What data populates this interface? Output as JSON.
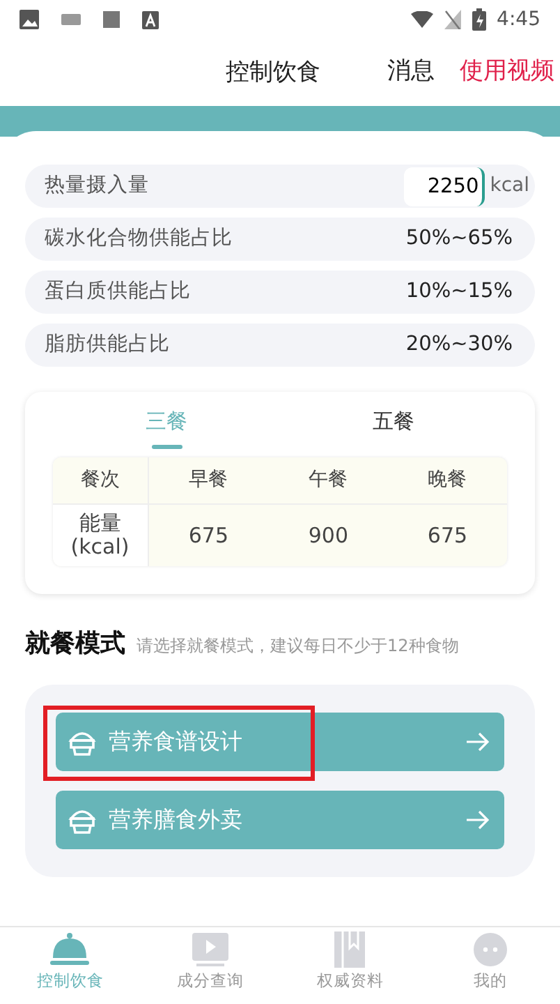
{
  "status_bar": {
    "time": "4:45"
  },
  "header": {
    "title": "控制饮食",
    "actions": [
      {
        "label": "消息",
        "kind": "plain"
      },
      {
        "label": "使用视频",
        "kind": "accent"
      }
    ]
  },
  "targets": [
    {
      "label": "热量摄入量",
      "kind": "input",
      "value": "2250",
      "unit": "kcal"
    },
    {
      "label": "碳水化合物供能占比",
      "kind": "text",
      "value": "50%~65%"
    },
    {
      "label": "蛋白质供能占比",
      "kind": "text",
      "value": "10%~15%"
    },
    {
      "label": "脂肪供能占比",
      "kind": "text",
      "value": "20%~30%"
    }
  ],
  "meal_tabs": [
    {
      "label": "三餐",
      "selected": true
    },
    {
      "label": "五餐",
      "selected": false
    }
  ],
  "table": {
    "columns": [
      "餐次",
      "早餐",
      "午餐",
      "晚餐"
    ],
    "rows": [
      {
        "cells": [
          "能量\n(kcal)",
          "675",
          "900",
          "675"
        ]
      }
    ]
  },
  "mode": {
    "title": "就餐模式",
    "hint": "请选择就餐模式，建议每日不少于12种食物",
    "options": [
      {
        "label": "营养食谱设计",
        "highlighted": true
      },
      {
        "label": "营养膳食外卖",
        "highlighted": false
      }
    ]
  },
  "bottom_nav": [
    {
      "label": "控制饮食",
      "selected": true
    },
    {
      "label": "成分查询",
      "selected": false
    },
    {
      "label": "权威资料",
      "selected": false
    },
    {
      "label": "我的",
      "selected": false
    }
  ]
}
